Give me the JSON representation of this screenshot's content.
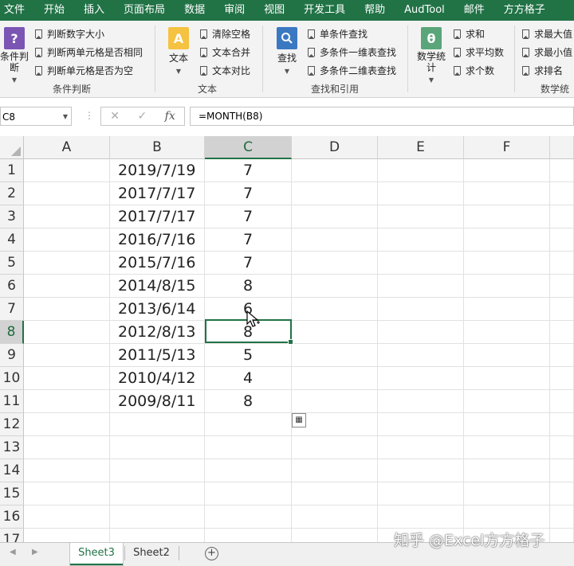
{
  "ribbon_tabs": [
    "文件",
    "开始",
    "插入",
    "页面布局",
    "数据",
    "审阅",
    "视图",
    "开发工具",
    "帮助",
    "AudTool",
    "邮件",
    "方方格子"
  ],
  "groups": {
    "condition": {
      "big_button": "条件判断",
      "items": [
        "判断数字大小",
        "判断两单元格是否相同",
        "判断单元格是否为空"
      ],
      "label": "条件判断"
    },
    "text": {
      "big_button": "文本",
      "items": [
        "清除空格",
        "文本合并",
        "文本对比"
      ],
      "label": "文本"
    },
    "lookup": {
      "big_button": "查找",
      "items": [
        "单条件查找",
        "多条件一维表查找",
        "多条件二维表查找"
      ],
      "label": "查找和引用"
    },
    "math": {
      "big_button": "数学统计",
      "items": [
        "求和",
        "求平均数",
        "求个数"
      ],
      "label": "数学统"
    },
    "extra": {
      "items": [
        "求最大值",
        "求最小值",
        "求排名"
      ]
    }
  },
  "formula_bar": {
    "name_box": "C8",
    "formula": "=MONTH(B8)",
    "cancel": "✕",
    "confirm": "✓",
    "fx": "fx"
  },
  "columns": [
    "A",
    "B",
    "C",
    "D",
    "E",
    "F"
  ],
  "selected_column": "C",
  "selected_row": 8,
  "rows": [
    1,
    2,
    3,
    4,
    5,
    6,
    7,
    8,
    9,
    10,
    11,
    12,
    13,
    14,
    15,
    16,
    17
  ],
  "data": [
    {
      "b": "2019/7/19",
      "c": "7"
    },
    {
      "b": "2017/7/17",
      "c": "7"
    },
    {
      "b": "2017/7/17",
      "c": "7"
    },
    {
      "b": "2016/7/16",
      "c": "7"
    },
    {
      "b": "2015/7/16",
      "c": "7"
    },
    {
      "b": "2014/8/15",
      "c": "8"
    },
    {
      "b": "2013/6/14",
      "c": "6"
    },
    {
      "b": "2012/8/13",
      "c": "8"
    },
    {
      "b": "2011/5/13",
      "c": "5"
    },
    {
      "b": "2010/4/12",
      "c": "4"
    },
    {
      "b": "2009/8/11",
      "c": "8"
    }
  ],
  "sheets": [
    "Sheet3",
    "Sheet2"
  ],
  "active_sheet": "Sheet3",
  "watermark": "知乎 @Excel方方格子",
  "colors": {
    "accent": "#217346"
  }
}
